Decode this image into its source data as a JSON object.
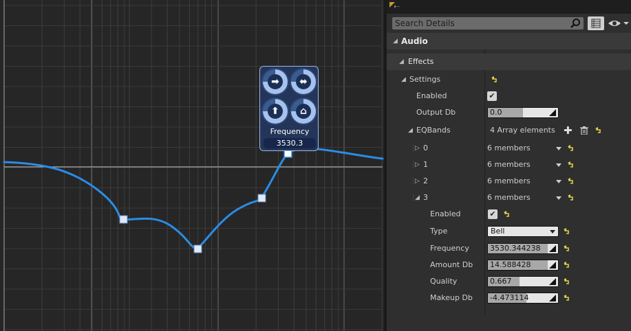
{
  "graph": {
    "popup": {
      "title": "Frequency",
      "value": "3530.3",
      "buttons": [
        "right-arrow-icon",
        "left-right-arrow-icon",
        "up-arrow-icon",
        "house-icon"
      ]
    }
  },
  "details": {
    "search": {
      "placeholder": "Search Details"
    },
    "categories": [
      {
        "label": "Audio"
      },
      {
        "label": "Effects"
      }
    ],
    "settings_label": "Settings",
    "enabled_label": "Enabled",
    "enabled_checked": true,
    "output_db": {
      "label": "Output Db",
      "value": "0.0",
      "fill": 0.5
    },
    "eqbands": {
      "label": "EQBands",
      "count_text": "4 Array elements",
      "items": [
        {
          "index": "0",
          "members": "6 members",
          "expanded": false
        },
        {
          "index": "1",
          "members": "6 members",
          "expanded": false
        },
        {
          "index": "2",
          "members": "6 members",
          "expanded": false
        },
        {
          "index": "3",
          "members": "6 members",
          "expanded": true
        }
      ]
    },
    "band3": {
      "enabled_label": "Enabled",
      "enabled_checked": true,
      "type_label": "Type",
      "type_value": "Bell",
      "frequency": {
        "label": "Frequency",
        "value": "3530.344238",
        "fill": 0.85
      },
      "amount_db": {
        "label": "Amount Db",
        "value": "14.588428",
        "fill": 0.85
      },
      "quality": {
        "label": "Quality",
        "value": "0.667",
        "fill": 0.45
      },
      "makeup_db": {
        "label": "Makeup Db",
        "value": "-4.473114",
        "fill": 0.55
      }
    }
  }
}
